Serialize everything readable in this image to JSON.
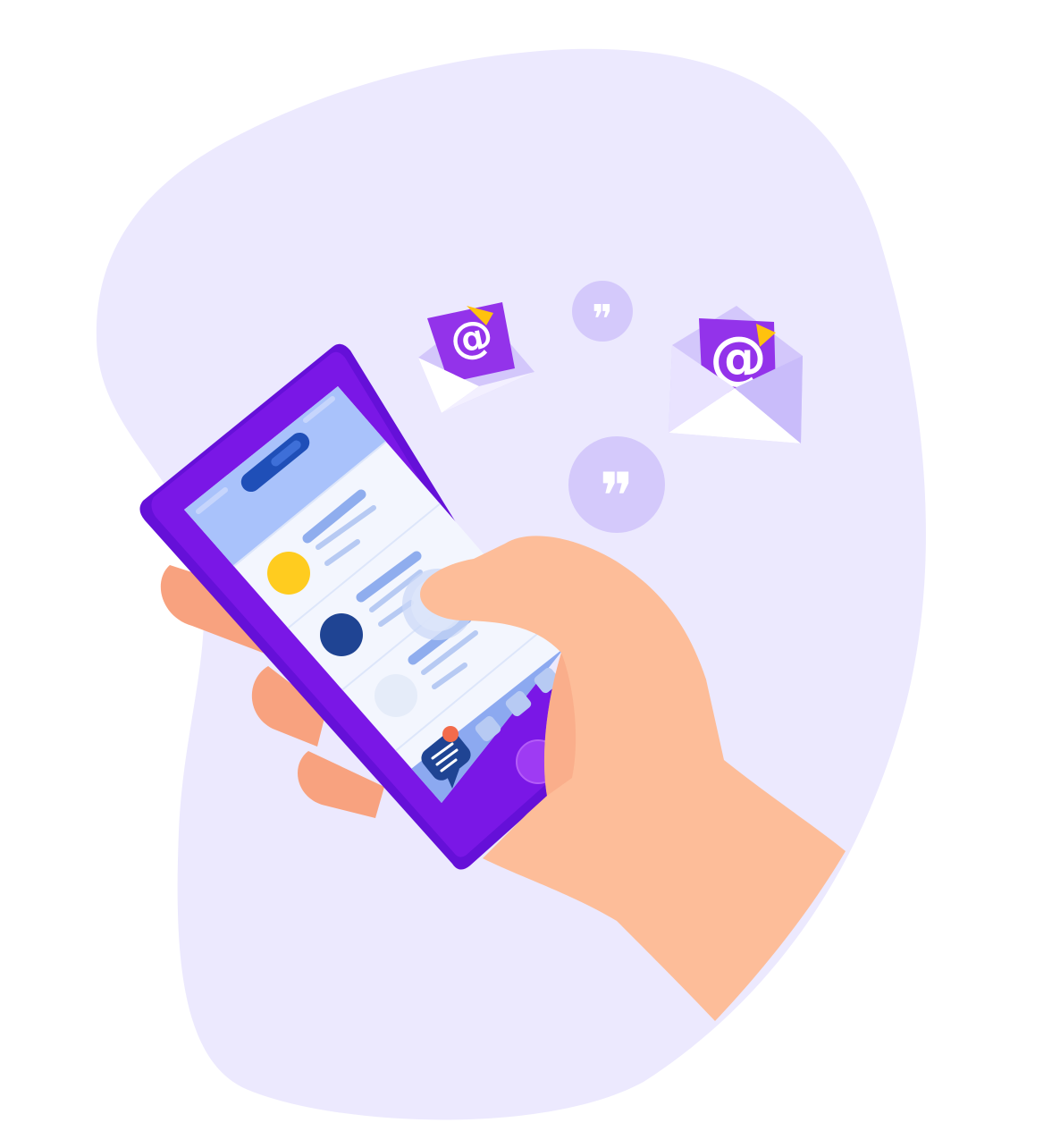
{
  "illustration": {
    "glyphs": {
      "at_sign": "@",
      "quote_mark": "❞"
    },
    "colors": {
      "blob": "#ECE9FE",
      "phone_body": "#7A17E6",
      "phone_body_dark": "#6510D8",
      "screen_header": "#A9C2FB",
      "screen_bg": "#F3F6FE",
      "screen_bottom_bar": "#8CA9F0",
      "header_button": "#1F4FB8",
      "text_line": "#8FADEE",
      "avatar_1": "#FFCC1F",
      "avatar_2": "#1F4493",
      "avatar_3": "#E5ECF9",
      "chat_bubble": "#1F4493",
      "notification_dot": "#F26B4B",
      "home_button": "#9E3BF3",
      "hand": "#FDBD99",
      "hand_shadow": "#F8A27F",
      "envelope": "#D3C7FB",
      "envelope_flap": "#FFFFFF",
      "letter": "#9333EA",
      "letter_fold": "#FFC20E",
      "quote_circle": "#D4C9FB"
    },
    "icons": [
      "email-envelope-icon",
      "quote-bubble-icon",
      "chat-bubble-icon",
      "notification-dot-icon"
    ]
  }
}
